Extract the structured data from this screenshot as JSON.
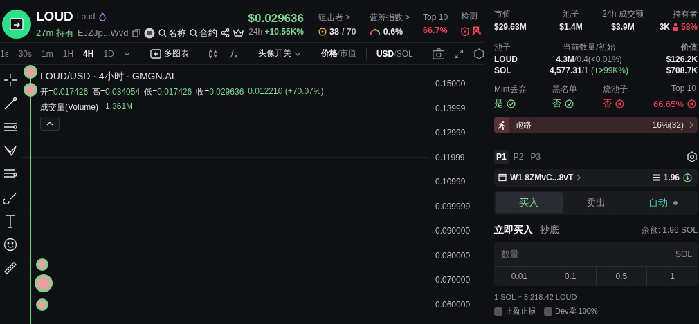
{
  "header": {
    "symbol": "LOUD",
    "name": "Loud",
    "age": "27m",
    "hold_label": "持有",
    "address": "EJZJp...Wvd",
    "links": [
      "名称",
      "合约"
    ],
    "price": "$0.029636",
    "change_label": "24h",
    "change": "+10.55K%",
    "metrics": [
      {
        "kind": "sniper",
        "label": "狙击者 >",
        "value": "38",
        "total": "/ 70"
      },
      {
        "kind": "gauge",
        "label": "蓝筹指数 >",
        "value": "0.6%"
      },
      {
        "kind": "danger",
        "label": "Top 10",
        "value": "66.7%"
      },
      {
        "kind": "risk",
        "label": "检测",
        "value": "风"
      }
    ]
  },
  "toolbar": {
    "intervals": [
      {
        "label": "1s",
        "selected": false
      },
      {
        "label": "30s",
        "selected": false
      },
      {
        "label": "1m",
        "selected": false
      },
      {
        "label": "1H",
        "selected": false
      },
      {
        "label": "4H",
        "selected": true
      },
      {
        "label": "1D",
        "selected": false
      }
    ],
    "multi_chart": "多图表",
    "avatar_toggle": "头像开关",
    "separator": "/",
    "price_mode": [
      {
        "label": "价格",
        "selected": true
      },
      {
        "label": "市值",
        "selected": false
      }
    ],
    "currency": [
      {
        "label": "USD",
        "selected": true
      },
      {
        "label": "SOL",
        "selected": false
      }
    ]
  },
  "chart": {
    "title": "LOUD/USD · 4小时 · GMGN.AI",
    "ohlc": [
      {
        "label": "开=",
        "value": "0.017426"
      },
      {
        "label": "高=",
        "value": "0.034054"
      },
      {
        "label": "低=",
        "value": "0.017426"
      },
      {
        "label": "收=",
        "value": "0.029636"
      }
    ],
    "change": "0.012210 (+70.07%)",
    "volume_label": "成交量(Volume)",
    "volume": "1.361M",
    "price_axis": [
      "0.15000",
      "0.13999",
      "0.12999",
      "0.11999",
      "0.10999",
      "0.099999",
      "0.090000",
      "0.080000",
      "0.070000",
      "0.060000"
    ]
  },
  "market": [
    {
      "label": "市值",
      "value": "$29.63M"
    },
    {
      "label": "池子",
      "value": "$1.4M"
    },
    {
      "label": "24h 成交额",
      "value": "$3.9M"
    }
  ],
  "holders": {
    "label": "持有者",
    "count": "3K",
    "share": "58%"
  },
  "pool": {
    "columns": [
      "池子",
      "当前数量/初始",
      "价值"
    ],
    "rows": [
      {
        "token": "LOUD",
        "amount": "4.3M",
        "initial": "/0.4",
        "pct": "(<0.01%)",
        "kind": "flat",
        "value": "$126.2K"
      },
      {
        "token": "SOL",
        "amount": "4,577.31",
        "initial": "/1",
        "pct": "(+>99K%)",
        "kind": "up",
        "value": "$708.7K"
      }
    ]
  },
  "checks": [
    {
      "label": "Mint丢弃",
      "value": "是",
      "ok": true
    },
    {
      "label": "黑名单",
      "value": "否",
      "ok": true
    },
    {
      "label": "烧池子",
      "value": "否",
      "ok": false
    },
    {
      "label": "Top 10",
      "value": "66.65%",
      "ok": false
    }
  ],
  "rug": {
    "label": "跑路",
    "value": "16%(32)"
  },
  "presets": [
    {
      "label": "P1",
      "selected": true
    },
    {
      "label": "P2",
      "selected": false
    },
    {
      "label": "P3",
      "selected": false
    }
  ],
  "wallet": {
    "name": "W1 8ZMvC...8vT",
    "balance": "1.96"
  },
  "trade_tabs": [
    {
      "kind": "buy",
      "label": "买入",
      "selected": true
    },
    {
      "kind": "sell",
      "label": "卖出",
      "selected": false
    },
    {
      "kind": "auto",
      "label": "自动",
      "selected": false
    }
  ],
  "order_tabs": [
    {
      "label": "立即买入",
      "selected": true
    },
    {
      "label": "抄底",
      "selected": false
    }
  ],
  "balance_label": "余额: 1.96 SOL",
  "amount": {
    "placeholder": "数量",
    "unit": "SOL"
  },
  "quick_amounts": [
    "0.01",
    "0.1",
    "0.5",
    "1"
  ],
  "rate": "1 SOL ≈ 5,218.42 LOUD",
  "options": [
    {
      "label": "止盈止损",
      "checked": false
    },
    {
      "label": "Dev卖 100%",
      "checked": false
    }
  ]
}
